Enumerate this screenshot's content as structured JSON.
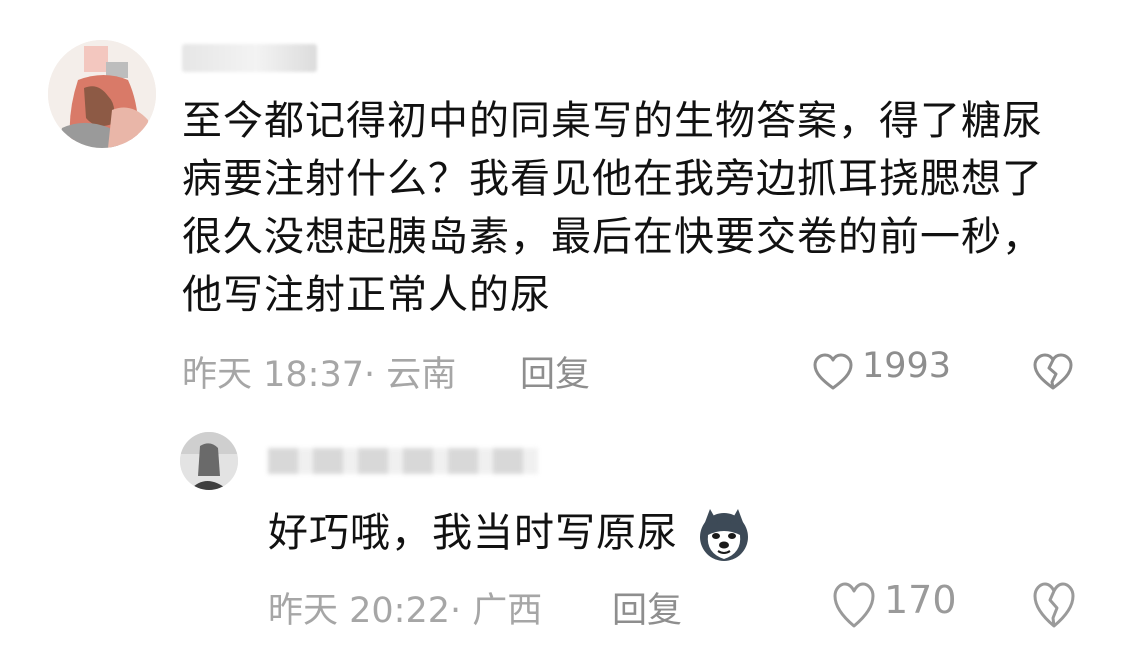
{
  "comment": {
    "text": "至今都记得初中的同桌写的生物答案，得了糖尿病要注射什么？我看见他在我旁边抓耳挠腮想了很久没想起胰岛素，最后在快要交卷的前一秒，他写注射正常人的尿",
    "meta": "昨天 18:37· 云南",
    "reply_label": "回复",
    "like_count": "1993",
    "avatar_icon": "user-avatar",
    "like_icon": "heart-outline-icon",
    "dislike_icon": "broken-heart-icon"
  },
  "reply": {
    "text": "好巧哦，我当时写原尿",
    "emoji_icon": "husky-doge-emoji",
    "meta": "昨天 20:22· 广西",
    "reply_label": "回复",
    "like_count": "170",
    "like_icon": "heart-outline-icon",
    "dislike_icon": "broken-heart-icon"
  },
  "colors": {
    "text": "#111111",
    "meta": "#a6a6a6",
    "action": "#8e8e8e"
  }
}
